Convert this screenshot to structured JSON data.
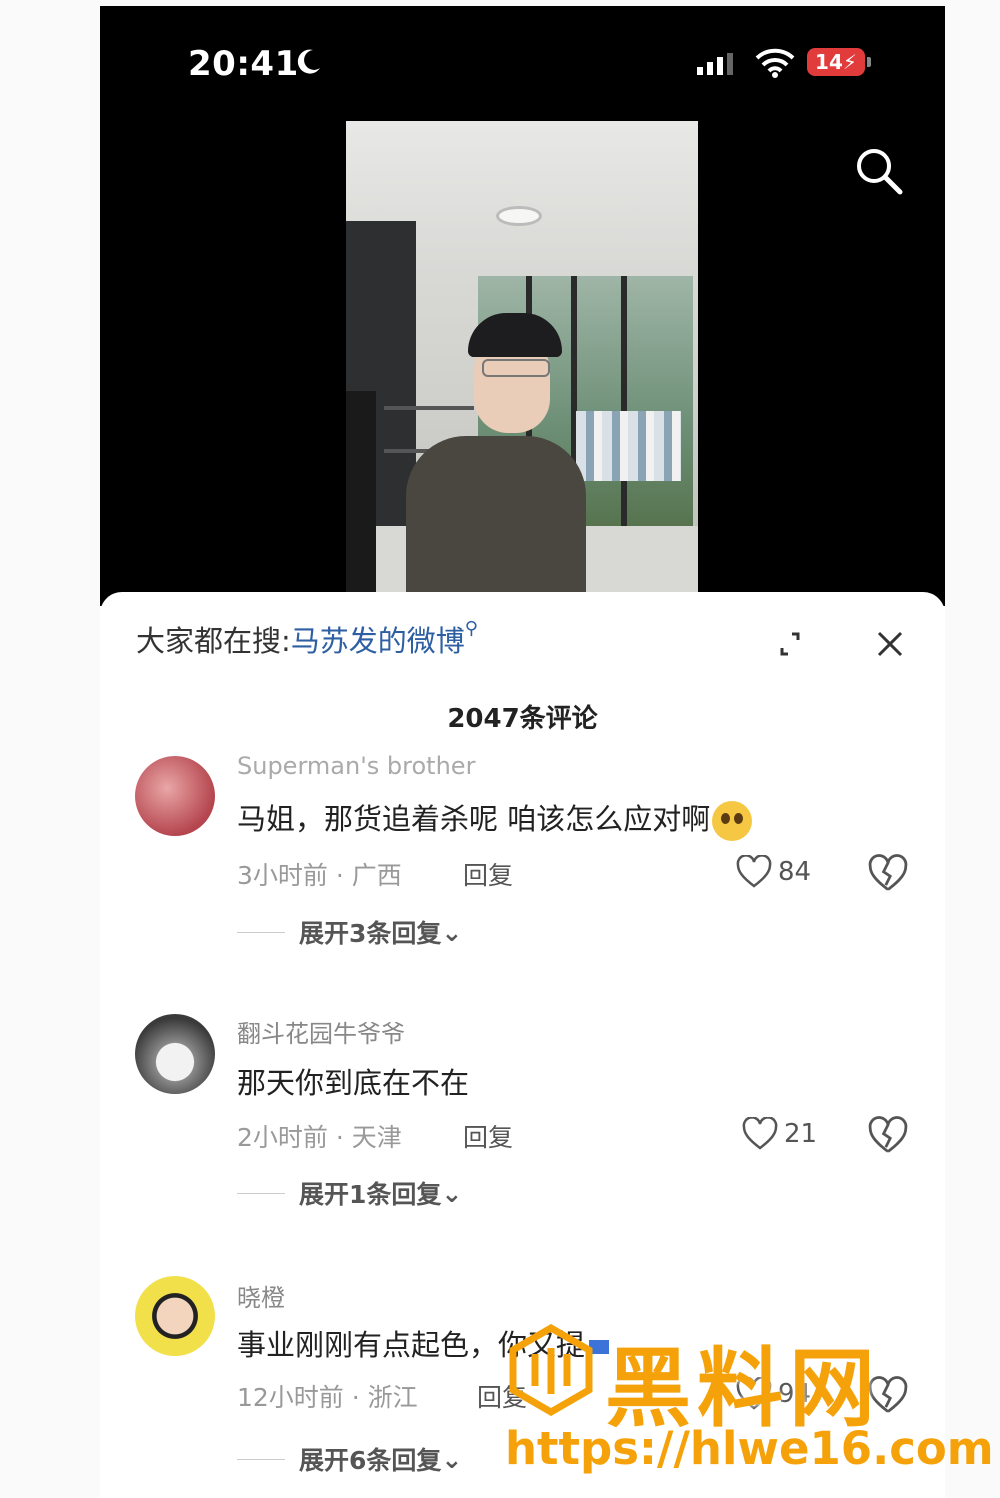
{
  "status_bar": {
    "time": "20:41",
    "battery": "14"
  },
  "sheet": {
    "hot_search_prefix": "大家都在搜:",
    "hot_search_term": "马苏发的微博",
    "comment_count": "2047条评论"
  },
  "comments": [
    {
      "username": "Superman's brother",
      "text": "马姐，那货追着杀呢 咱该怎么应对啊",
      "meta": "3小时前 · 广西",
      "reply": "回复",
      "likes": "84",
      "expand": "展开3条回复"
    },
    {
      "username": "翻斗花园牛爷爷",
      "text": "那天你到底在不在",
      "meta": "2小时前 · 天津",
      "reply": "回复",
      "likes": "21",
      "expand": "展开1条回复"
    },
    {
      "username": "晓橙",
      "text": "事业刚刚有点起色，你又提",
      "meta": "12小时前 · 浙江",
      "reply": "回复",
      "likes": "94",
      "expand": "展开6条回复"
    }
  ],
  "watermark": {
    "title": "黑料网",
    "url": "https://hlwe16.com"
  },
  "colors": {
    "link": "#2e5fa3",
    "battery": "#e23b3b",
    "watermark": "#f5a20a"
  }
}
